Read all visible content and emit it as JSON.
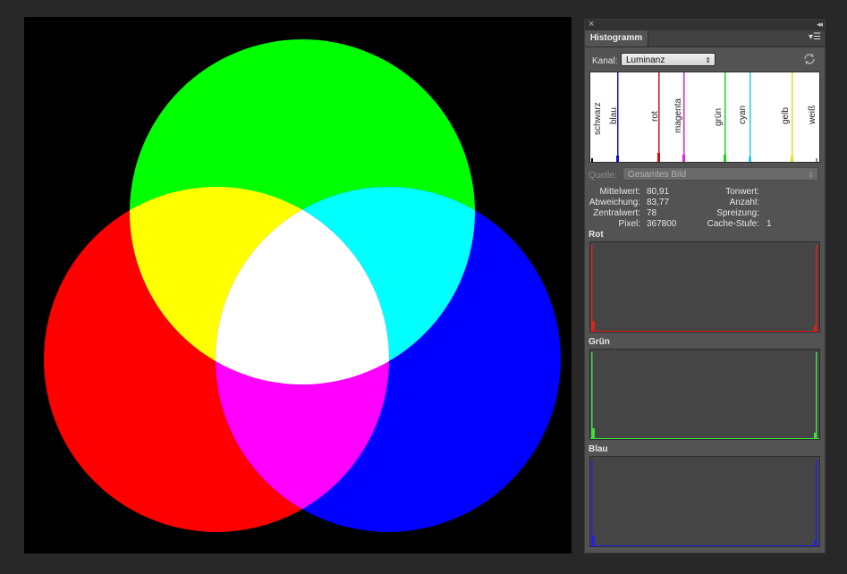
{
  "panel": {
    "tab_label": "Histogramm",
    "channel": {
      "label": "Kanal:",
      "value": "Luminanz"
    },
    "luminance_labels": [
      "schwarz",
      "blau",
      "rot",
      "magenta",
      "grün",
      "cyan",
      "gelb",
      "weiß"
    ],
    "source": {
      "label": "Quelle:",
      "value": "Gesamtes Bild"
    },
    "stats_left": [
      {
        "label": "Mittelwert:",
        "value": "80,91"
      },
      {
        "label": "Abweichung:",
        "value": "83,77"
      },
      {
        "label": "Zentralwert:",
        "value": "78"
      },
      {
        "label": "Pixel:",
        "value": "367800"
      }
    ],
    "stats_right": [
      {
        "label": "Tonwert:",
        "value": ""
      },
      {
        "label": "Anzahl:",
        "value": ""
      },
      {
        "label": "Spreizung:",
        "value": ""
      },
      {
        "label": "Cache-Stufe:",
        "value": "1"
      }
    ],
    "channels": [
      {
        "name": "Rot",
        "color": "#e0201c"
      },
      {
        "name": "Grün",
        "color": "#3ee03e"
      },
      {
        "name": "Blau",
        "color": "#2424e0"
      }
    ]
  },
  "colors": {
    "red": "#ff0000",
    "green": "#00ff00",
    "blue": "#0000ff",
    "yellow": "#ffff00",
    "cyan": "#00ffff",
    "magenta": "#ff00ff",
    "white": "#ffffff"
  }
}
